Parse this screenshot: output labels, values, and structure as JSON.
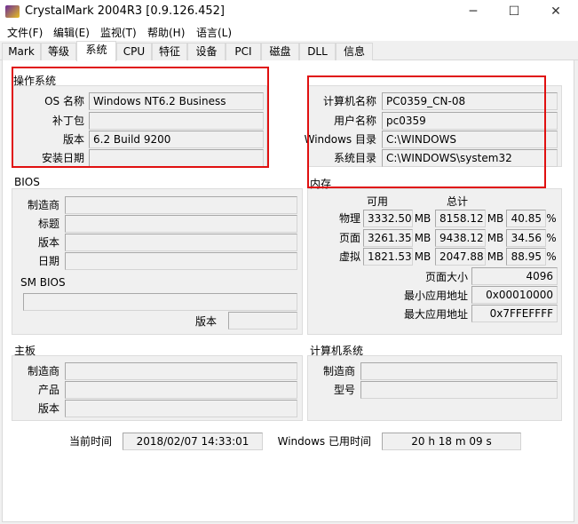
{
  "window": {
    "title": "CrystalMark 2004R3 [0.9.126.452]",
    "minimize": "─",
    "maximize": "☐",
    "close": "✕"
  },
  "menu": [
    "文件(F)",
    "编辑(E)",
    "监视(T)",
    "帮助(H)",
    "语言(L)"
  ],
  "tabs": [
    "Mark",
    "等级",
    "系统",
    "CPU",
    "特征",
    "设备",
    "PCI",
    "磁盘",
    "DLL",
    "信息"
  ],
  "active_tab": "系统",
  "os": {
    "title": "操作系统",
    "rows": [
      {
        "label": "OS 名称",
        "value": "Windows NT6.2 Business"
      },
      {
        "label": "补丁包",
        "value": ""
      },
      {
        "label": "版本",
        "value": "6.2 Build 9200"
      },
      {
        "label": "安装日期",
        "value": ""
      }
    ]
  },
  "computer": {
    "rows": [
      {
        "label": "计算机名称",
        "value": "PC0359_CN-08"
      },
      {
        "label": "用户名称",
        "value": "pc0359"
      },
      {
        "label": "Windows 目录",
        "value": "C:\\WINDOWS"
      },
      {
        "label": "系统目录",
        "value": "C:\\WINDOWS\\system32"
      }
    ]
  },
  "bios": {
    "title": "BIOS",
    "rows": [
      {
        "label": "制造商",
        "value": ""
      },
      {
        "label": "标题",
        "value": ""
      },
      {
        "label": "版本",
        "value": ""
      },
      {
        "label": "日期",
        "value": ""
      }
    ],
    "smbios_title": "SM BIOS",
    "smbios_value": "",
    "smbios_version_label": "版本",
    "smbios_version": ""
  },
  "memory": {
    "title": "内存",
    "col_available": "可用",
    "col_total": "总计",
    "unit": "MB",
    "pct": "%",
    "rows": [
      {
        "label": "物理",
        "available": "3332.50",
        "total": "8158.12",
        "percent": "40.85"
      },
      {
        "label": "页面",
        "available": "3261.35",
        "total": "9438.12",
        "percent": "34.56"
      },
      {
        "label": "虚拟",
        "available": "1821.53",
        "total": "2047.88",
        "percent": "88.95"
      }
    ],
    "extra": [
      {
        "label": "页面大小",
        "value": "4096"
      },
      {
        "label": "最小应用地址",
        "value": "0x00010000"
      },
      {
        "label": "最大应用地址",
        "value": "0x7FFEFFFF"
      }
    ]
  },
  "motherboard": {
    "title": "主板",
    "rows": [
      {
        "label": "制造商",
        "value": ""
      },
      {
        "label": "产品",
        "value": ""
      },
      {
        "label": "版本",
        "value": ""
      }
    ]
  },
  "system": {
    "title": "计算机系统",
    "rows": [
      {
        "label": "制造商",
        "value": ""
      },
      {
        "label": "型号",
        "value": ""
      }
    ]
  },
  "footer": {
    "time_label": "当前时间",
    "time_value": "2018/02/07 14:33:01",
    "uptime_label": "Windows 已用时间",
    "uptime_value": "20 h 18 m 09 s"
  },
  "colors": {
    "highlight": "#e01010"
  }
}
